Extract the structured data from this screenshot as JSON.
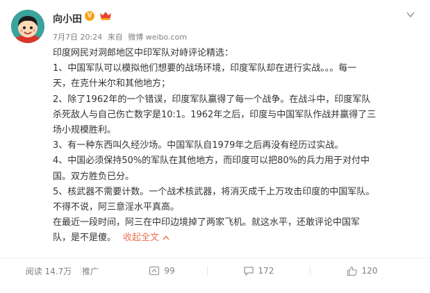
{
  "post": {
    "username": "向小田",
    "verified_badge": "V",
    "time": "7月7日 20:24",
    "source_prefix": "来自",
    "source": "微博 weibo.com",
    "lines": [
      "印度网民对洞郎地区中印军队对峙评论精选：",
      "1、中国军队可以模拟他们想要的战场环境，印度军队却在进行实战。。。每一",
      "天，在克什米尔和其他地方；",
      "2、除了1962年的一个错误，印度军队赢得了每一个战争。在战斗中，印度军队",
      "杀死敌人与自己伤亡数字是10:1。1962年之后，印度与中国军队作战并赢得了三",
      "场小规模胜利。",
      "3、有一种东西叫久经沙场。中国军队自1979年之后再没有经历过实战。",
      "4、中国必须保持50%的军队在其他地方，而印度可以把80%的兵力用于对付中",
      "国。双方胜负已分。",
      "5、核武器不需要计数。一个战术核武器，将消灭成千上万攻击印度的中国军队。",
      "不得不说，阿三意淫水平真高。",
      "在最近一段时间，阿三在中印边境掉了两家飞机。就这水平，还敢评论中国军",
      "队，是不是傻。"
    ],
    "collapse_label": "收起全文",
    "collapse_chevron": "^"
  },
  "footer": {
    "views": "阅读 14.7万",
    "promote": "推广",
    "repost_count": "99",
    "comment_count": "172",
    "like_count": "120"
  },
  "icons": {
    "more": "chevron-down-icon",
    "repost": "repost-icon",
    "comment": "comment-icon",
    "like": "thumbs-up-icon",
    "member": "member-crown-icon"
  },
  "colors": {
    "text": "#333333",
    "meta": "#808080",
    "link": "#eb7350",
    "verified": "#f7a21b",
    "member_red": "#e8412e"
  }
}
